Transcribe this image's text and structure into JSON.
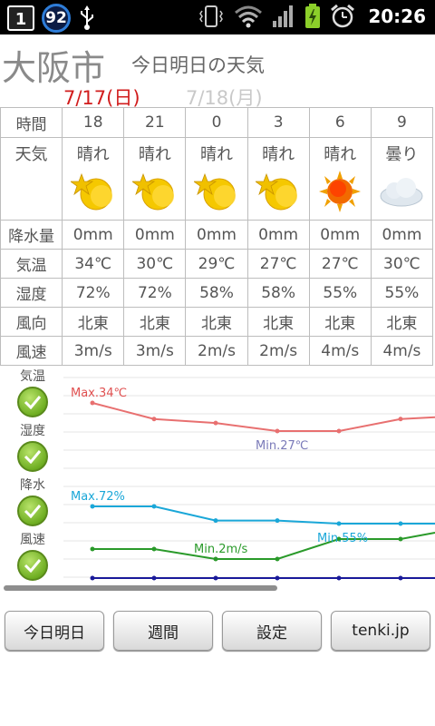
{
  "status_bar": {
    "notification_count": "1",
    "battery_badge": "92",
    "time": "20:26",
    "icons": [
      "notification-icon",
      "usb-icon",
      "vibrate-icon",
      "wifi-icon",
      "signal-icon",
      "battery-charging-icon",
      "alarm-icon"
    ]
  },
  "header": {
    "city": "大阪市",
    "subtitle": "今日明日の天気",
    "date_today": "7/17(日)",
    "date_tomorrow": "7/18(月)"
  },
  "table": {
    "row_labels": {
      "time": "時間",
      "sky": "天気",
      "rain": "降水量",
      "temp": "気温",
      "humidity": "湿度",
      "wind_dir": "風向",
      "wind_speed": "風速"
    },
    "columns": [
      {
        "time": "18",
        "sky": "晴れ",
        "icon": "sun-moon-icon",
        "rain": "0mm",
        "temp": "34℃",
        "humidity": "72%",
        "wind_dir": "北東",
        "wind_speed": "3m/s"
      },
      {
        "time": "21",
        "sky": "晴れ",
        "icon": "sun-moon-icon",
        "rain": "0mm",
        "temp": "30℃",
        "humidity": "72%",
        "wind_dir": "北東",
        "wind_speed": "3m/s"
      },
      {
        "time": "0",
        "sky": "晴れ",
        "icon": "sun-moon-icon",
        "rain": "0mm",
        "temp": "29℃",
        "humidity": "58%",
        "wind_dir": "北東",
        "wind_speed": "2m/s"
      },
      {
        "time": "3",
        "sky": "晴れ",
        "icon": "sun-moon-icon",
        "rain": "0mm",
        "temp": "27℃",
        "humidity": "58%",
        "wind_dir": "北東",
        "wind_speed": "2m/s"
      },
      {
        "time": "6",
        "sky": "晴れ",
        "icon": "sun-icon",
        "rain": "0mm",
        "temp": "27℃",
        "humidity": "55%",
        "wind_dir": "北東",
        "wind_speed": "4m/s"
      },
      {
        "time": "9",
        "sky": "曇り",
        "icon": "cloud-icon",
        "rain": "0mm",
        "temp": "30℃",
        "humidity": "55%",
        "wind_dir": "北東",
        "wind_speed": "4m/s"
      }
    ]
  },
  "graph": {
    "legend": [
      "気温",
      "湿度",
      "降水",
      "風速"
    ],
    "labels": {
      "temp_max": "Max.34℃",
      "temp_min": "Min.27℃",
      "humidity_max": "Max.72%",
      "humidity_min": "Min.55%",
      "wind_min": "Min.2m/s"
    },
    "colors": {
      "temp": "#e87070",
      "humidity": "#1aa7d8",
      "wind": "#2a9a2a",
      "rain": "#1a1a9a",
      "temp_min_label": "#7a7ab8"
    }
  },
  "chart_data": {
    "type": "line",
    "x": [
      "18",
      "21",
      "0",
      "3",
      "6",
      "9"
    ],
    "series": [
      {
        "name": "気温",
        "values": [
          34,
          30,
          29,
          27,
          27,
          30
        ]
      },
      {
        "name": "湿度",
        "values": [
          72,
          72,
          58,
          58,
          55,
          55
        ]
      },
      {
        "name": "降水",
        "values": [
          0,
          0,
          0,
          0,
          0,
          0
        ]
      },
      {
        "name": "風速",
        "values": [
          3,
          3,
          2,
          2,
          4,
          4
        ]
      }
    ]
  },
  "buttons": {
    "today_tomorrow": "今日明日",
    "weekly": "週間",
    "settings": "設定",
    "site": "tenki.jp"
  }
}
